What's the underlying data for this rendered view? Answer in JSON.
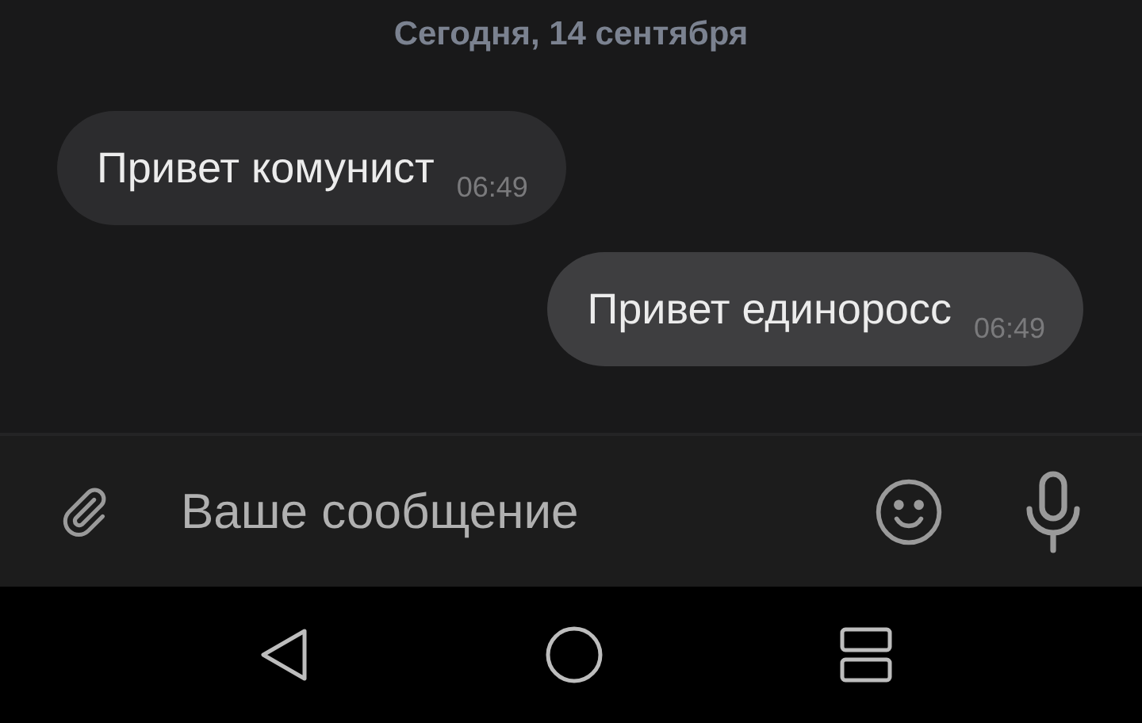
{
  "date_separator": "Сегодня, 14 сентября",
  "messages": [
    {
      "kind": "incoming",
      "text": "Привет комунист",
      "time": "06:49"
    },
    {
      "kind": "outgoing",
      "text": "Привет единоросс",
      "time": "06:49"
    }
  ],
  "composer": {
    "placeholder": "Ваше сообщение"
  }
}
